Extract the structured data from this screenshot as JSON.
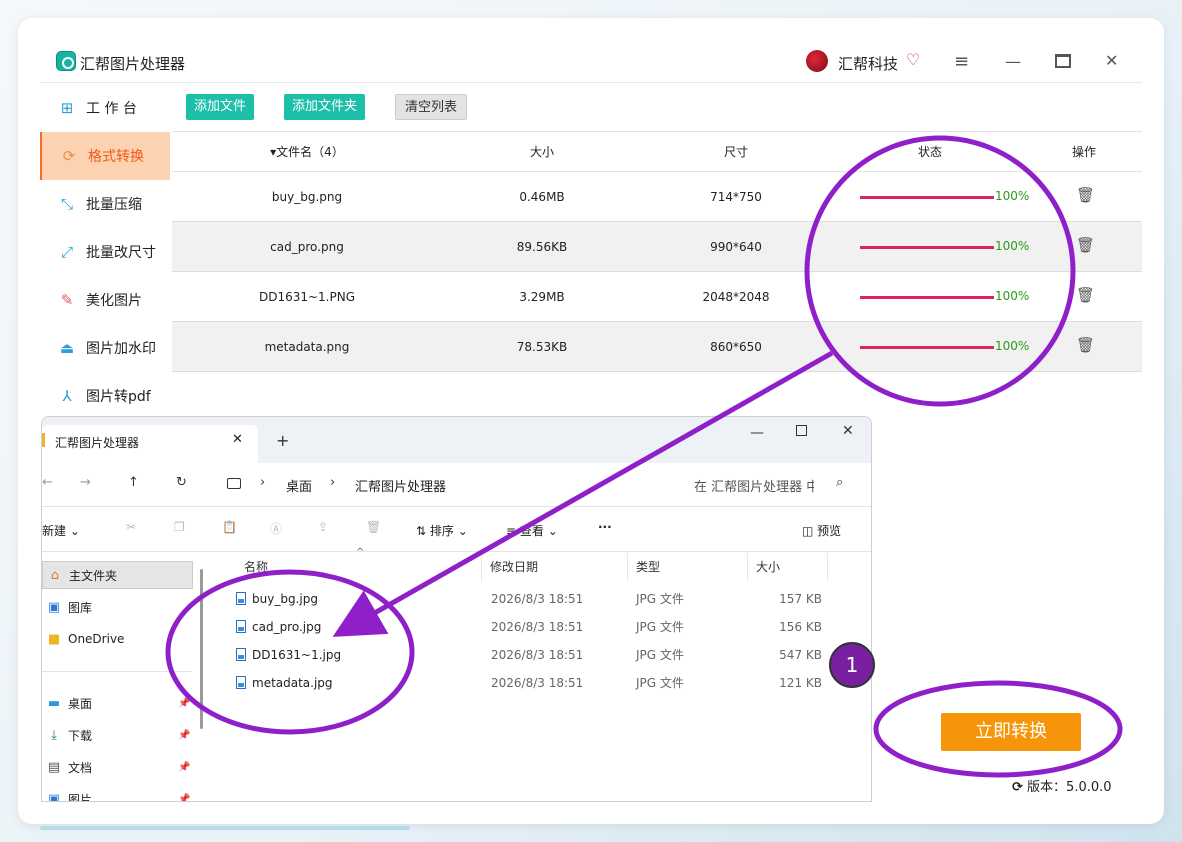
{
  "app": {
    "title": "汇帮图片处理器",
    "brand": "汇帮科技",
    "version_label": "版本：5.0.0.0"
  },
  "sidebar": {
    "items": [
      {
        "label": "工 作 台",
        "icon": "grid-icon"
      },
      {
        "label": "格式转换",
        "icon": "format-convert-icon",
        "active": true
      },
      {
        "label": "批量压缩",
        "icon": "compress-icon"
      },
      {
        "label": "批量改尺寸",
        "icon": "resize-icon"
      },
      {
        "label": "美化图片",
        "icon": "beautify-icon"
      },
      {
        "label": "图片加水印",
        "icon": "watermark-icon"
      },
      {
        "label": "图片转pdf",
        "icon": "pdf-icon"
      }
    ]
  },
  "toolbar": {
    "add_file": "添加文件",
    "add_folder": "添加文件夹",
    "clear_list": "清空列表"
  },
  "table": {
    "headers": {
      "name": "▾文件名（4）",
      "size": "大小",
      "dimensions": "尺寸",
      "status": "状态",
      "action": "操作"
    },
    "rows": [
      {
        "name": "buy_bg.png",
        "size": "0.46MB",
        "dimensions": "714*750",
        "progress": 100,
        "progress_label": "100%"
      },
      {
        "name": "cad_pro.png",
        "size": "89.56KB",
        "dimensions": "990*640",
        "progress": 100,
        "progress_label": "100%"
      },
      {
        "name": "DD1631~1.PNG",
        "size": "3.29MB",
        "dimensions": "2048*2048",
        "progress": 100,
        "progress_label": "100%"
      },
      {
        "name": "metadata.png",
        "size": "78.53KB",
        "dimensions": "860*650",
        "progress": 100,
        "progress_label": "100%"
      }
    ]
  },
  "start_button": "立即转换",
  "explorer": {
    "tab_title": "汇帮图片处理器",
    "breadcrumb": [
      "桌面",
      "汇帮图片处理器"
    ],
    "search_placeholder": "在 汇帮图片处理器 中",
    "commands": {
      "new": "新建",
      "sort": "排序",
      "view": "查看",
      "more": "···",
      "preview": "预览"
    },
    "sidebar": [
      {
        "label": "主文件夹",
        "icon": "home-icon"
      },
      {
        "label": "图库",
        "icon": "gallery-icon"
      },
      {
        "label": "OneDrive",
        "icon": "folder-icon"
      },
      {
        "label": "桌面",
        "icon": "desktop-icon"
      },
      {
        "label": "下载",
        "icon": "download-icon"
      },
      {
        "label": "文档",
        "icon": "document-icon"
      },
      {
        "label": "图片",
        "icon": "pictures-icon"
      }
    ],
    "columns": {
      "name": "名称",
      "modified": "修改日期",
      "type": "类型",
      "size": "大小"
    },
    "files": [
      {
        "name": "buy_bg.jpg",
        "modified": "2026/8/3 18:51",
        "type": "JPG 文件",
        "size": "157 KB"
      },
      {
        "name": "cad_pro.jpg",
        "modified": "2026/8/3 18:51",
        "type": "JPG 文件",
        "size": "156 KB"
      },
      {
        "name": "DD1631~1.jpg",
        "modified": "2026/8/3 18:51",
        "type": "JPG 文件",
        "size": "547 KB"
      },
      {
        "name": "metadata.jpg",
        "modified": "2026/8/3 18:51",
        "type": "JPG 文件",
        "size": "121 KB"
      }
    ]
  },
  "annotation": {
    "badge": "1",
    "color": "#8e1fc9"
  },
  "colors": {
    "accent_green": "#1ebfa8",
    "active_orange": "#f46b2a",
    "start_orange": "#f7950a",
    "progress": "#d8245f"
  }
}
